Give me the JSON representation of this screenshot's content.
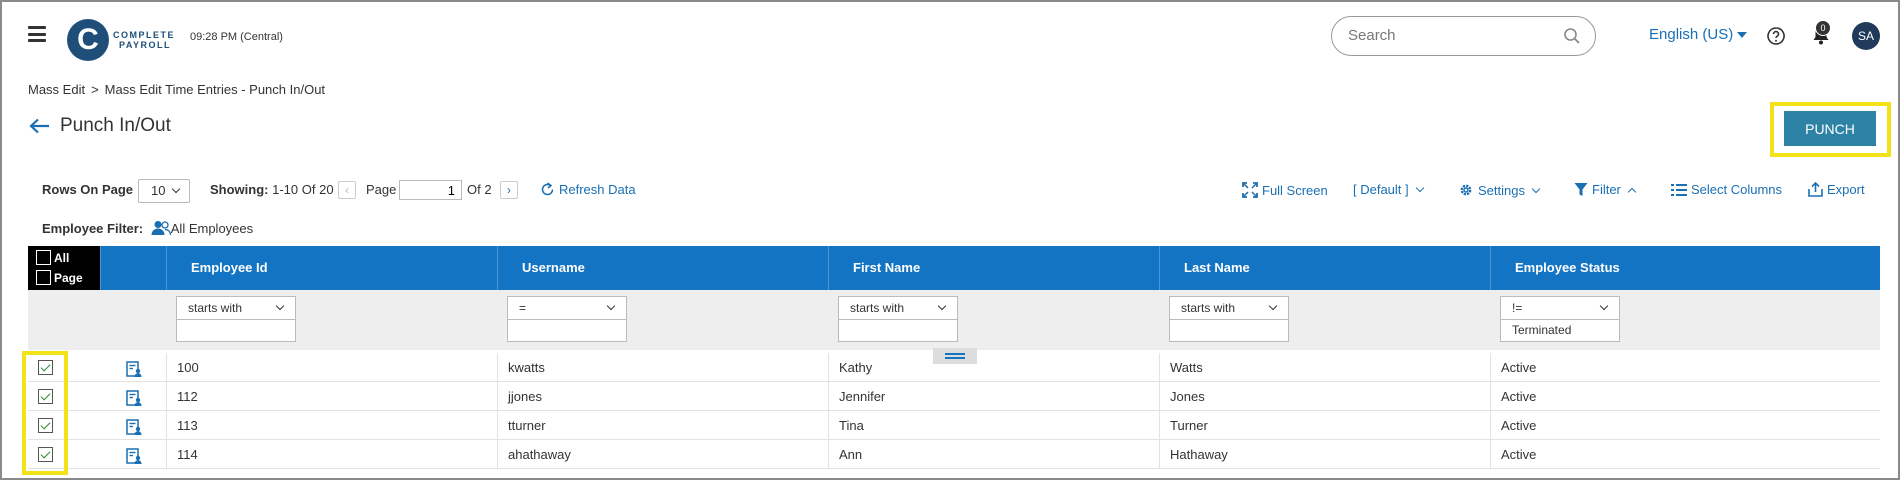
{
  "header": {
    "logo_letter": "C",
    "logo_line1": "COMPLETE",
    "logo_line2": "PAYROLL",
    "clock": "09:28 PM (Central)",
    "search_placeholder": "Search",
    "language": "English (US)",
    "notification_count": "0",
    "user_initials": "SA"
  },
  "breadcrumb": {
    "items": [
      "Mass Edit",
      "Mass Edit Time Entries - Punch In/Out"
    ],
    "separator": ">"
  },
  "page": {
    "title": "Punch In/Out",
    "punch_label": "PUNCH"
  },
  "toolbar": {
    "rows_on_page_label": "Rows On Page",
    "rows_on_page_value": "10",
    "showing_label": "Showing:",
    "showing_value": "1-10 Of 20",
    "page_label": "Page",
    "page_value": "1",
    "page_of": "Of 2",
    "refresh_label": "Refresh Data",
    "full_screen_label": "Full Screen",
    "default_label": "[ Default ]",
    "settings_label": "Settings",
    "filter_label": "Filter",
    "select_columns_label": "Select Columns",
    "export_label": "Export"
  },
  "employee_filter": {
    "label": "Employee Filter:",
    "value": "All Employees"
  },
  "grid": {
    "select_all_label": "All",
    "select_page_label": "Page",
    "columns": [
      {
        "label": "Employee Id",
        "operator": "starts with",
        "value": ""
      },
      {
        "label": "Username",
        "operator": "=",
        "value": ""
      },
      {
        "label": "First Name",
        "operator": "starts with",
        "value": ""
      },
      {
        "label": "Last Name",
        "operator": "starts with",
        "value": ""
      },
      {
        "label": "Employee Status",
        "operator": "!=",
        "value": "Terminated"
      }
    ],
    "rows": [
      {
        "checked": true,
        "employee_id": "100",
        "username": "kwatts",
        "first_name": "Kathy",
        "last_name": "Watts",
        "status": "Active"
      },
      {
        "checked": true,
        "employee_id": "112",
        "username": "jjones",
        "first_name": "Jennifer",
        "last_name": "Jones",
        "status": "Active"
      },
      {
        "checked": true,
        "employee_id": "113",
        "username": "tturner",
        "first_name": "Tina",
        "last_name": "Turner",
        "status": "Active"
      },
      {
        "checked": true,
        "employee_id": "114",
        "username": "ahathaway",
        "first_name": "Ann",
        "last_name": "Hathaway",
        "status": "Active"
      }
    ]
  },
  "colors": {
    "header_blue": "#1474c4",
    "punch_button": "#2d82a6",
    "link_blue": "#1a6fb3",
    "highlight_yellow": "#f2e218",
    "logo_navy": "#1f4e79"
  }
}
